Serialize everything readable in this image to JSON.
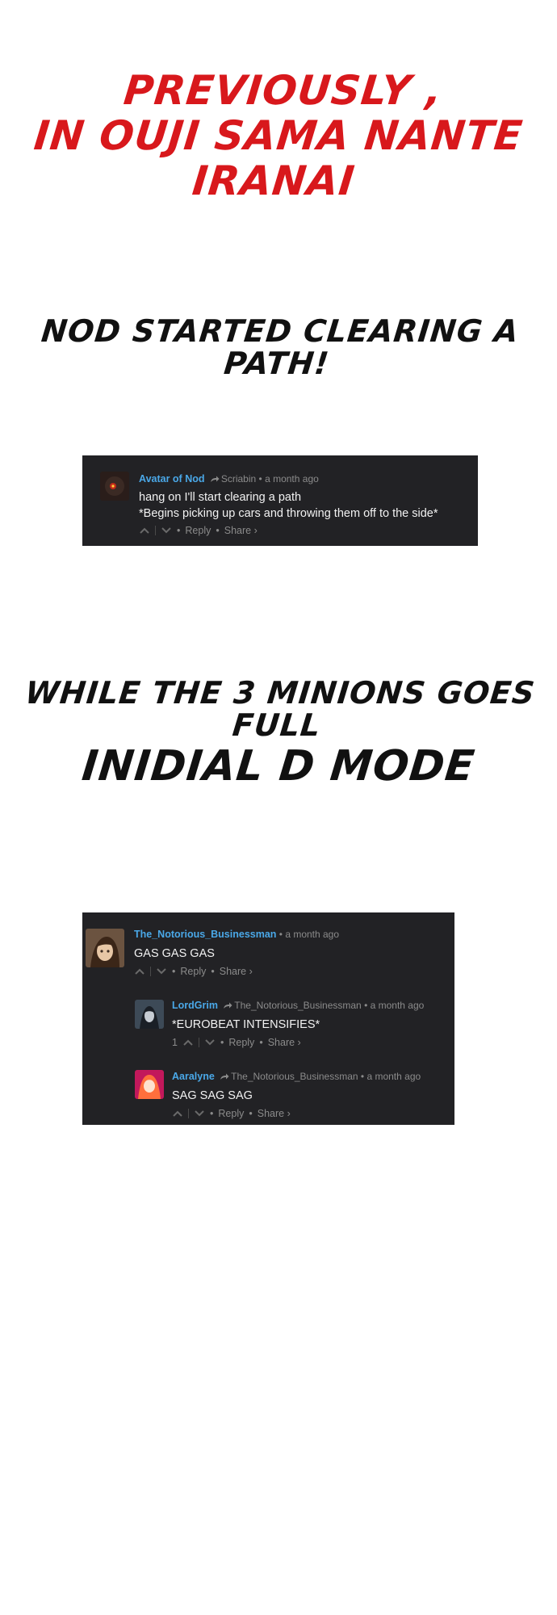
{
  "intro": {
    "line1": "PREVIOUSLY ,",
    "line2": "IN OUJI SAMA NANTE",
    "line3": "IRANAI"
  },
  "caption1": {
    "line1": "NOD STARTED CLEARING A",
    "line2": "PATH!"
  },
  "comment1": {
    "author": "Avatar of Nod",
    "reply_to": "Scriabin",
    "time": "• a month ago",
    "line1": "hang on I'll start clearing a path",
    "line2": "*Begins picking up cars and throwing them off to the side*",
    "reply_label": "Reply",
    "share_label": "Share ›"
  },
  "caption2": {
    "line1": "WHILE THE 3 MINIONS GOES",
    "line2": "FULL",
    "line3": "INIDIAL D MODE"
  },
  "thread": {
    "top": {
      "author": "The_Notorious_Businessman",
      "time": "• a month ago",
      "text": "GAS GAS GAS",
      "reply_label": "Reply",
      "share_label": "Share ›"
    },
    "replies": [
      {
        "author": "LordGrim",
        "reply_to": "The_Notorious_Businessman",
        "time": "• a month ago",
        "text": "*EUROBEAT INTENSIFIES*",
        "upvotes": "1",
        "reply_label": "Reply",
        "share_label": "Share ›"
      },
      {
        "author": "Aaralyne",
        "reply_to": "The_Notorious_Businessman",
        "time": "• a month ago",
        "text": "SAG SAG SAG",
        "reply_label": "Reply",
        "share_label": "Share ›"
      }
    ]
  },
  "colors": {
    "title_red": "#d8181c",
    "panel_bg": "#222225",
    "author_blue": "#4aa8e8"
  },
  "icons": [
    "reply-arrow-icon",
    "upvote-icon",
    "downvote-icon"
  ]
}
